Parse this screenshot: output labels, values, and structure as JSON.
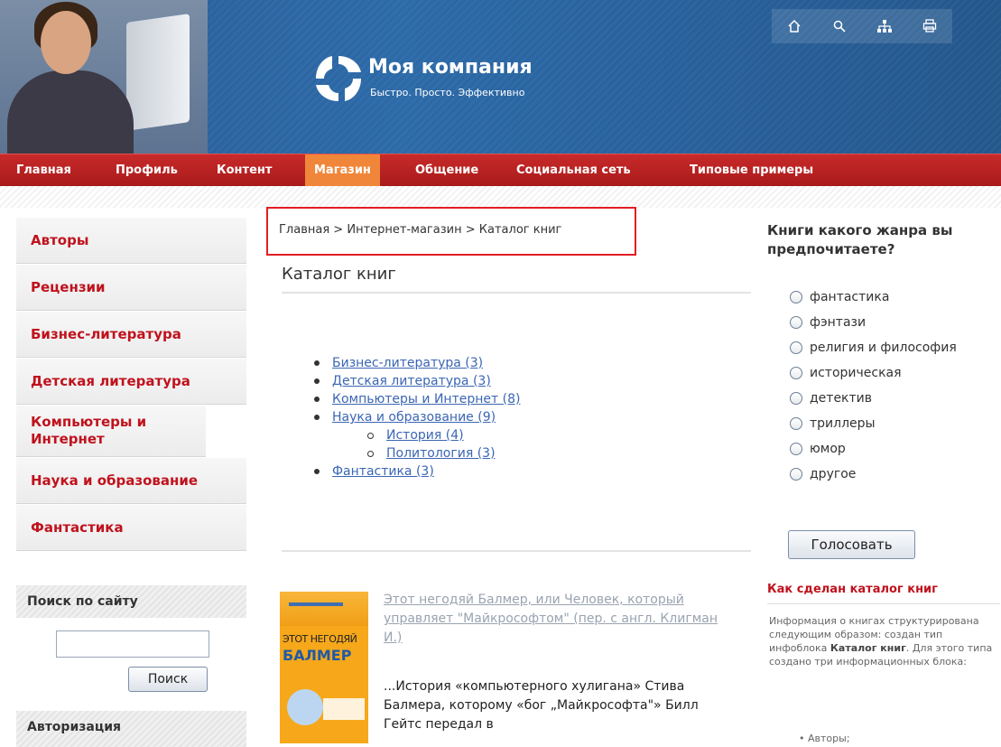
{
  "header": {
    "title": "Моя компания",
    "slogan": "Быстро. Просто. Эффективно",
    "tools": [
      "home-icon",
      "search-icon",
      "sitemap-icon",
      "print-icon"
    ],
    "colors": {
      "header_blue": "#2c6aa8",
      "menu_red": "#b31f1f",
      "active_orange": "#f0863a",
      "accent_red": "#c0121d"
    }
  },
  "menu": {
    "items": [
      {
        "label": "Главная"
      },
      {
        "label": "Профиль"
      },
      {
        "label": "Контент"
      },
      {
        "label": "Магазин",
        "active": true
      },
      {
        "label": "Общение"
      },
      {
        "label": "Социальная сеть"
      },
      {
        "label": "Типовые примеры"
      }
    ]
  },
  "sidebar": {
    "items": [
      {
        "label": "Авторы"
      },
      {
        "label": "Рецензии"
      },
      {
        "label": "Бизнес-литература"
      },
      {
        "label": "Детская литература"
      },
      {
        "label": "Компьютеры и Интернет"
      },
      {
        "label": "Наука и образование"
      },
      {
        "label": "Фантастика"
      }
    ],
    "search": {
      "title": "Поиск по сайту",
      "value": "",
      "button": "Поиск"
    },
    "auth": {
      "title": "Авторизация"
    }
  },
  "breadcrumb": {
    "items": [
      "Главная",
      "Интернет-магазин",
      "Каталог книг"
    ],
    "separator": ">"
  },
  "main": {
    "title": "Каталог книг",
    "catalog": [
      {
        "label": "Бизнес-литература (3)"
      },
      {
        "label": "Детская литература (3)"
      },
      {
        "label": "Компьютеры и Интернет (8)"
      },
      {
        "label": "Наука и образование (9)"
      },
      {
        "label": "История (4)",
        "sub": true
      },
      {
        "label": "Политология (3)",
        "sub": true
      },
      {
        "label": "Фантастика (3)"
      }
    ],
    "book": {
      "cover_line1": "ЭТОТ НЕГОДЯЙ",
      "cover_line2": "БАЛМЕР",
      "title": "Этот негодяй Балмер, или Человек, который управляет \"Майкрософтом\" (пер. с англ. Клигман И.)",
      "description": "...История «компьютерного хулигана» Стива Балмера, которому «бог „Майкрософта\"» Билл Гейтс передал в"
    }
  },
  "poll": {
    "question": "Книги какого жанра вы предпочитаете?",
    "options": [
      "фантастика",
      "фэнтази",
      "религия и философия",
      "историческая",
      "детектив",
      "триллеры",
      "юмор",
      "другое"
    ],
    "button": "Голосовать"
  },
  "info": {
    "title": "Как сделан каталог книг",
    "text_1": "Информация о книгах структурирована следующим образом: создан тип инфоблока ",
    "text_bold": "Каталог книг",
    "text_2": ". Для этого типа создано три информационных блока:",
    "list_item": "Авторы;"
  }
}
